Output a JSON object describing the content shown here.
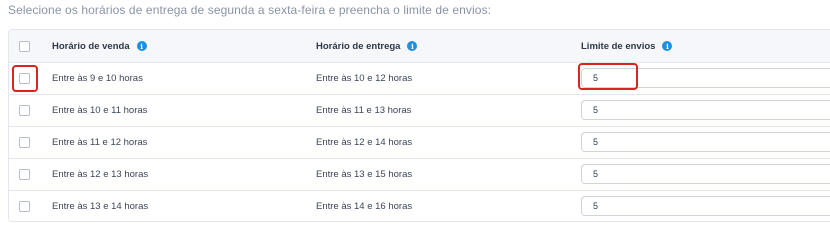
{
  "instruction": "Selecione os horários de entrega de segunda a sexta-feira e preencha o limite de envios:",
  "table": {
    "headers": {
      "venda": "Horário de venda",
      "entrega": "Horário de entrega",
      "limite": "Limite de envios",
      "info_glyph": "i"
    },
    "rows": [
      {
        "venda": "Entre às 9 e 10 horas",
        "entrega": "Entre às 10 e 12 horas",
        "limite": "5"
      },
      {
        "venda": "Entre às 10 e 11 horas",
        "entrega": "Entre às 11 e 13 horas",
        "limite": "5"
      },
      {
        "venda": "Entre às 11 e 12 horas",
        "entrega": "Entre às 12 e 14 horas",
        "limite": "5"
      },
      {
        "venda": "Entre às 12 e 13 horas",
        "entrega": "Entre às 13 e 15 horas",
        "limite": "5"
      },
      {
        "venda": "Entre às 13 e 14 horas",
        "entrega": "Entre às 14 e 16 horas",
        "limite": "5"
      }
    ]
  },
  "colors": {
    "info_icon": "#1e8fe1",
    "highlight": "#d6261f"
  },
  "icons": [
    "info-icon",
    "checkbox"
  ]
}
